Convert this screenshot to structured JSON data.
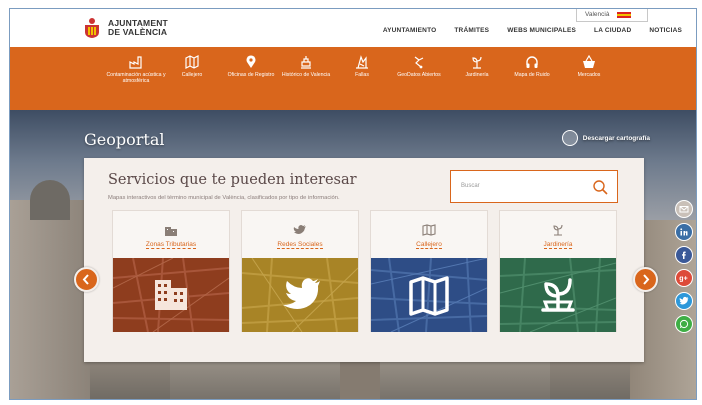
{
  "header": {
    "logo_line1": "AJUNTAMENT",
    "logo_line2": "DE VALÈNCIA",
    "language": "Valencià",
    "nav": [
      "AYUNTAMIENTO",
      "TRÁMITES",
      "WEBS MUNICIPALES",
      "LA CIUDAD",
      "NOTICIAS"
    ]
  },
  "categories": [
    {
      "label": "Contaminación acústica y atmosférica",
      "icon": "factory-icon"
    },
    {
      "label": "Callejero",
      "icon": "map-icon"
    },
    {
      "label": "Oficinas de Registro",
      "icon": "pin-icon"
    },
    {
      "label": "Histórico de Valencia",
      "icon": "monument-icon"
    },
    {
      "label": "Fallas",
      "icon": "fallas-icon"
    },
    {
      "label": "GeoDatos Abiertos",
      "icon": "geodata-icon"
    },
    {
      "label": "Jardinería",
      "icon": "plant-icon"
    },
    {
      "label": "Mapa de Ruido",
      "icon": "headphones-icon"
    },
    {
      "label": "Mercados",
      "icon": "basket-icon"
    }
  ],
  "hero": {
    "title": "Geoportal",
    "download_label": "Descargar cartografía"
  },
  "panel": {
    "title": "Servicios que te pueden interesar",
    "subtitle": "Mapas interactivos del término municipal de València, clasificados por tipo de información.",
    "search_placeholder": "Buscar",
    "cards": [
      {
        "label": "Zonas Tributarias",
        "icon": "buildings-icon",
        "color": "#8e3d1e"
      },
      {
        "label": "Redes Sociales",
        "icon": "twitter-icon",
        "color": "#a88426"
      },
      {
        "label": "Callejero",
        "icon": "map-icon",
        "color": "#2e4d86"
      },
      {
        "label": "Jardinería",
        "icon": "plant-icon",
        "color": "#2f6a4b"
      }
    ]
  },
  "social": [
    {
      "icon": "email-icon",
      "color": "#c9c0b8"
    },
    {
      "icon": "linkedin-icon",
      "color": "#3a6ea5"
    },
    {
      "icon": "facebook-icon",
      "color": "#3b5998"
    },
    {
      "icon": "googleplus-icon",
      "color": "#dd4b39"
    },
    {
      "icon": "twitter-icon",
      "color": "#2d98da"
    },
    {
      "icon": "whatsapp-icon",
      "color": "#3fae45"
    }
  ],
  "colors": {
    "accent": "#d9661c"
  }
}
